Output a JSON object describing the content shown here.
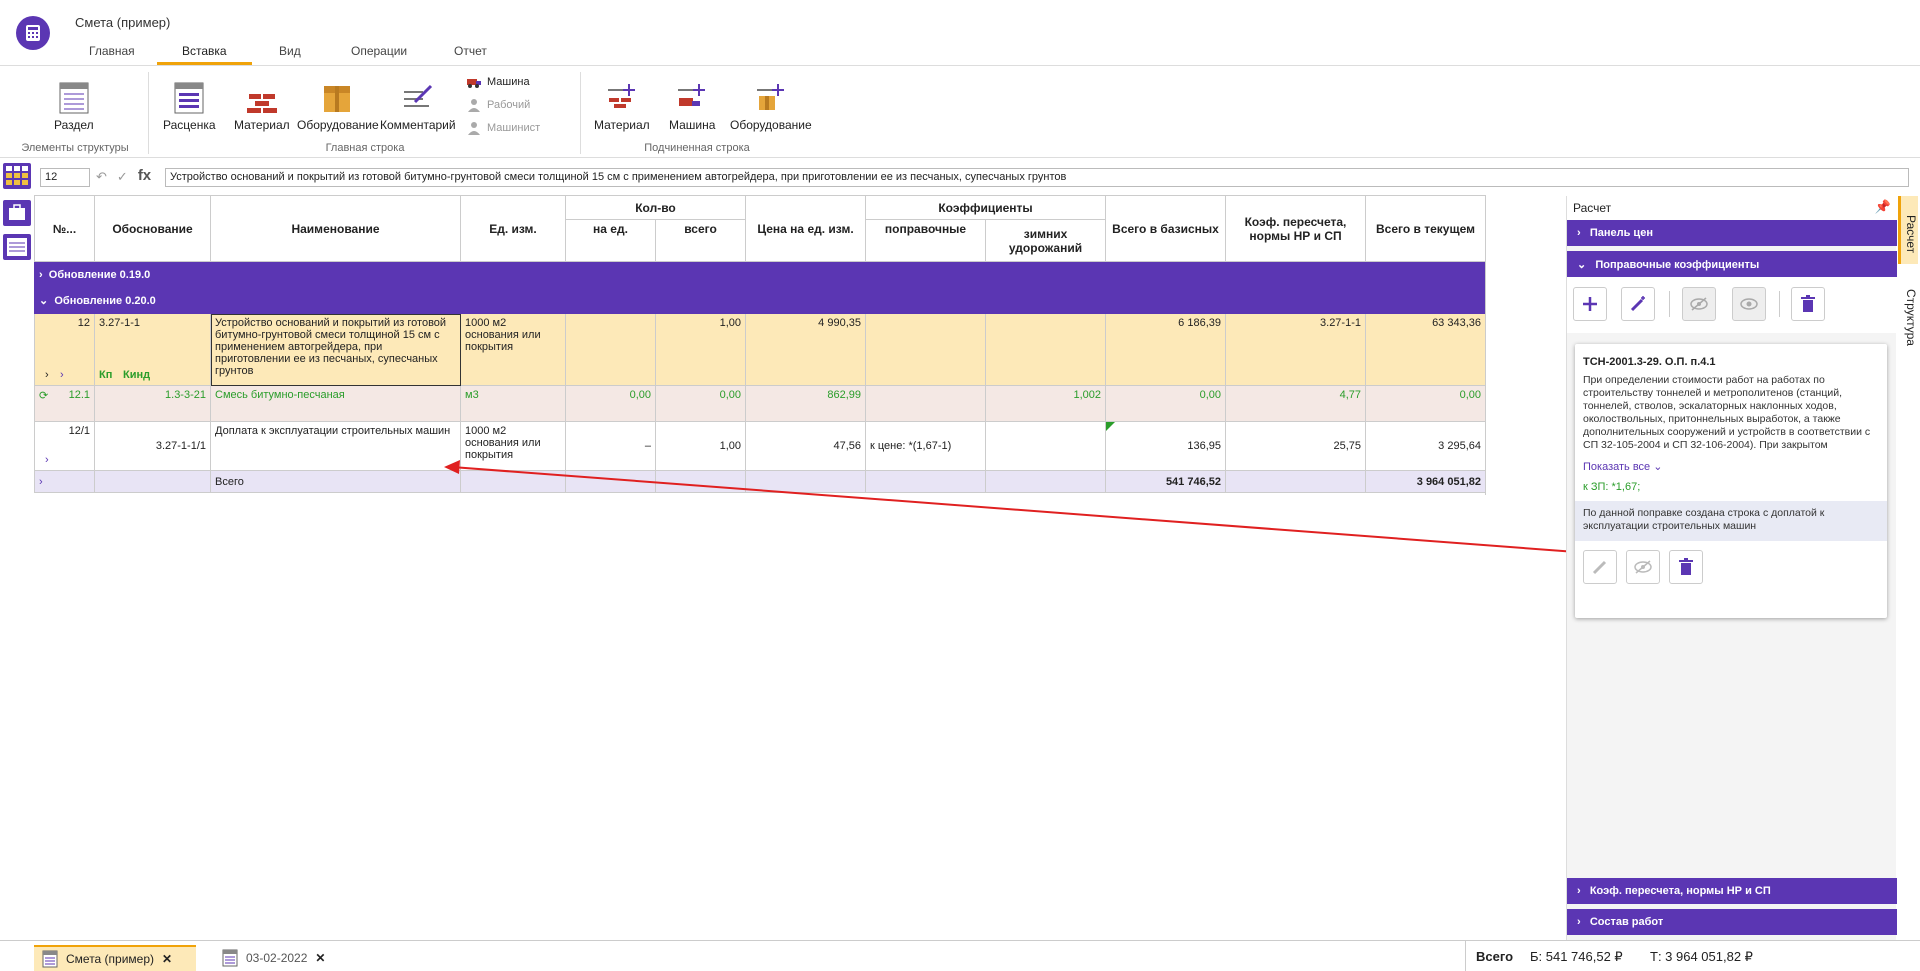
{
  "window": {
    "title": "Смета (пример)"
  },
  "menu": {
    "tabs": [
      "Главная",
      "Вставка",
      "Вид",
      "Операции",
      "Отчет"
    ],
    "active": "Вставка"
  },
  "ribbon": {
    "structure": {
      "razdel": "Раздел",
      "group_label": "Элементы структуры"
    },
    "main": {
      "rascenka": "Расценка",
      "material": "Материал",
      "oborudovanie": "Оборудование",
      "kommentariy": "Комментарий",
      "mashina": "Машина",
      "rabochiy": "Рабочий",
      "mashinist": "Машинист",
      "group_label": "Главная строка"
    },
    "sub": {
      "material": "Материал",
      "mashina": "Машина",
      "oborudovanie": "Оборудование",
      "group_label": "Подчиненная строка"
    }
  },
  "formula": {
    "cell": "12",
    "fx": "fx",
    "value": "Устройство оснований и покрытий из готовой битумно-грунтовой смеси толщиной 15 см с применением автогрейдера, при приготовлении ее из песчаных, супесчаных грунтов"
  },
  "table": {
    "headers": {
      "no": "№...",
      "basis": "Обоснование",
      "name": "Наименование",
      "unit": "Ед. изм.",
      "qty": "Кол-во",
      "per_unit": "на ед.",
      "total": "всего",
      "price": "Цена на ед. изм.",
      "coefs": "Коэффициенты",
      "corr": "поправочные",
      "winter": "зимних удорожаний",
      "sum_base": "Всего в базисных",
      "recalc": "Коэф. пересчета, нормы НР и СП",
      "sum_cur": "Всего в текущем"
    },
    "groups": [
      "Обновление 0.19.0",
      "Обновление 0.20.0"
    ],
    "row1": {
      "no": "12",
      "basis": "3.27-1-1",
      "kp": "Кп",
      "kind": "Кинд",
      "name": "Устройство оснований и покрытий из готовой битумно-грунтовой смеси толщиной 15 см с применением автогрейдера, при приготовлении ее из песчаных, супесчаных грунтов",
      "unit": "1000 м2 основания или покрытия",
      "total": "1,00",
      "price": "4 990,35",
      "sum_base": "6 186,39",
      "recalc": "3.27-1-1",
      "sum_cur": "63 343,36"
    },
    "row2": {
      "no": "12.1",
      "basis": "1.3-3-21",
      "name": "Смесь битумно-песчаная",
      "unit": "м3",
      "per_unit": "0,00",
      "total": "0,00",
      "price": "862,99",
      "winter": "1,002",
      "sum_base": "0,00",
      "recalc": "4,77",
      "sum_cur": "0,00"
    },
    "row3": {
      "no": "12/1",
      "basis": "3.27-1-1/1",
      "name": "Доплата к эксплуатации строительных машин",
      "unit": "1000 м2 основания или покрытия",
      "per_unit": "–",
      "total": "1,00",
      "price": "47,56",
      "corr": "к цене: *(1,67-1)",
      "sum_base": "136,95",
      "recalc": "25,75",
      "sum_cur": "3 295,64"
    },
    "total": {
      "label": "Всего",
      "sum_base": "541 746,52",
      "sum_cur": "3 964 051,82"
    }
  },
  "panel": {
    "title": "Расчет",
    "sections": [
      "Панель цен",
      "Поправочные коэффициенты",
      "Коэф. пересчета, нормы НР и СП",
      "Состав работ"
    ],
    "vtabs": [
      "Расчет",
      "Структура"
    ],
    "card": {
      "code": "ТСН-2001.3-29. О.П. п.4.1",
      "text": "При определении стоимости работ на работах по строительству тоннелей и метрополитенов (станций, тоннелей, стволов, эскалаторных наклонных ходов, околоствольных, притоннельных выработок, а также дополнительных сооружений и устройств в соответствии с СП 32-105-2004 и СП 32-106-2004). При закрытом (подземном) способе работ, включая...",
      "show_all": "Показать все",
      "coef": "к ЗП: *1,67;",
      "note": "По данной поправке создана строка с доплатой к эксплуатации строительных машин"
    }
  },
  "bottom": {
    "tabs": [
      "Смета (пример)",
      "03-02-2022"
    ],
    "total_label": "Всего",
    "base": "Б: 541 746,52 ₽",
    "current": "Т: 3 964 051,82 ₽"
  },
  "colors": {
    "accent": "#5b36b3",
    "highlight": "#fde9b8",
    "tab_underline": "#f0a30a",
    "arrow": "#e02020"
  }
}
